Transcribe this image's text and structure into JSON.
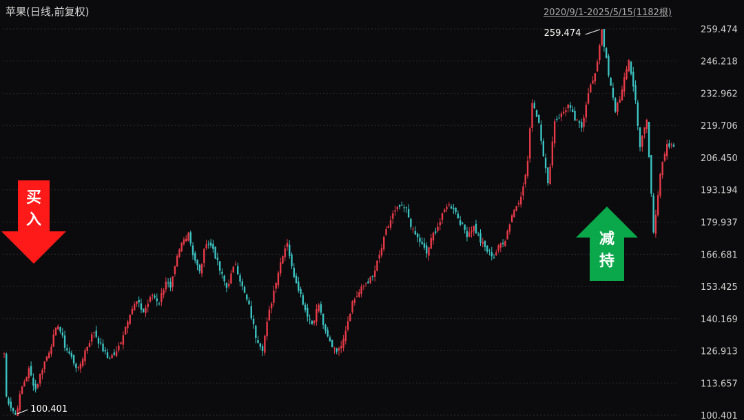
{
  "header": {
    "title": "苹果(日线,前复权)",
    "range": "2020/9/1-2025/5/15(1182根)"
  },
  "chart_data": {
    "type": "candlestick",
    "y_ticks": [
      "259.474",
      "246.218",
      "232.962",
      "219.706",
      "206.450",
      "193.194",
      "179.937",
      "166.681",
      "153.425",
      "140.169",
      "126.913",
      "113.657",
      "100.401"
    ],
    "ylim": [
      100.401,
      259.474
    ],
    "high_label": "259.474",
    "low_label": "100.401",
    "buy_label": [
      "买",
      "入"
    ],
    "sell_label": [
      "减",
      "持"
    ],
    "colors": {
      "up": "#e83a48",
      "down": "#3cc3c3",
      "buy": "#ff1a1a",
      "sell": "#0aa84a"
    },
    "path": [
      [
        0,
        126
      ],
      [
        1,
        108
      ],
      [
        3,
        104
      ],
      [
        5,
        100.4
      ],
      [
        8,
        112
      ],
      [
        11,
        119
      ],
      [
        14,
        111
      ],
      [
        17,
        120
      ],
      [
        20,
        127
      ],
      [
        24,
        138
      ],
      [
        27,
        129
      ],
      [
        30,
        124
      ],
      [
        33,
        119
      ],
      [
        36,
        127
      ],
      [
        40,
        135
      ],
      [
        43,
        129
      ],
      [
        46,
        124
      ],
      [
        50,
        126
      ],
      [
        53,
        134
      ],
      [
        56,
        143
      ],
      [
        59,
        147
      ],
      [
        62,
        143
      ],
      [
        66,
        150
      ],
      [
        69,
        147
      ],
      [
        72,
        156
      ],
      [
        74,
        152
      ],
      [
        77,
        165
      ],
      [
        79,
        171
      ],
      [
        82,
        176
      ],
      [
        84,
        167
      ],
      [
        87,
        159
      ],
      [
        90,
        172
      ],
      [
        93,
        169
      ],
      [
        96,
        160
      ],
      [
        99,
        153
      ],
      [
        101,
        158
      ],
      [
        103,
        163
      ],
      [
        106,
        153
      ],
      [
        109,
        145
      ],
      [
        112,
        133
      ],
      [
        115,
        128
      ],
      [
        118,
        143
      ],
      [
        121,
        156
      ],
      [
        124,
        167
      ],
      [
        126,
        172
      ],
      [
        128,
        161
      ],
      [
        131,
        153
      ],
      [
        134,
        144
      ],
      [
        137,
        138
      ],
      [
        140,
        146
      ],
      [
        143,
        134
      ],
      [
        146,
        129
      ],
      [
        149,
        127
      ],
      [
        152,
        136
      ],
      [
        155,
        147
      ],
      [
        158,
        151
      ],
      [
        161,
        155
      ],
      [
        164,
        157
      ],
      [
        167,
        166
      ],
      [
        170,
        176
      ],
      [
        173,
        183
      ],
      [
        176,
        186
      ],
      [
        179,
        185
      ],
      [
        182,
        176
      ],
      [
        185,
        172
      ],
      [
        188,
        167
      ],
      [
        191,
        175
      ],
      [
        194,
        180
      ],
      [
        197,
        187
      ],
      [
        200,
        186
      ],
      [
        203,
        180
      ],
      [
        206,
        175
      ],
      [
        209,
        178
      ],
      [
        212,
        172
      ],
      [
        215,
        168
      ],
      [
        218,
        166
      ],
      [
        221,
        171
      ],
      [
        223,
        173
      ],
      [
        226,
        183
      ],
      [
        229,
        189
      ],
      [
        231,
        194
      ],
      [
        233,
        205
      ],
      [
        235,
        230
      ],
      [
        238,
        221
      ],
      [
        240,
        208
      ],
      [
        242,
        195
      ],
      [
        245,
        222
      ],
      [
        248,
        224
      ],
      [
        251,
        228
      ],
      [
        254,
        222
      ],
      [
        257,
        219
      ],
      [
        260,
        234
      ],
      [
        263,
        240
      ],
      [
        266,
        259.5
      ],
      [
        269,
        240
      ],
      [
        272,
        226
      ],
      [
        275,
        234
      ],
      [
        278,
        247
      ],
      [
        281,
        230
      ],
      [
        283,
        211
      ],
      [
        286,
        222
      ],
      [
        289,
        176
      ],
      [
        292,
        200
      ],
      [
        295,
        211
      ],
      [
        298,
        211
      ]
    ]
  }
}
